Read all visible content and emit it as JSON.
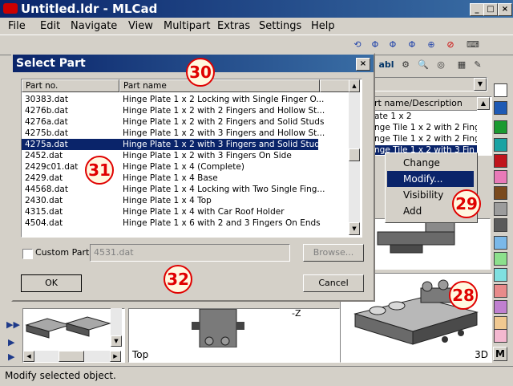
{
  "app": {
    "title": "Untitled.ldr - MLCad"
  },
  "menu": [
    "File",
    "Edit",
    "Navigate",
    "View",
    "Multipart",
    "Extras",
    "Settings",
    "Help"
  ],
  "dialog": {
    "title": "Select Part",
    "columns": [
      "Part no.",
      "Part name"
    ],
    "rows": [
      {
        "no": "30383.dat",
        "name": "Hinge Plate  1 x  2 Locking with Single Finger O..."
      },
      {
        "no": "4276b.dat",
        "name": "Hinge Plate  1 x  2 with 2 Fingers and Hollow St..."
      },
      {
        "no": "4276a.dat",
        "name": "Hinge Plate  1 x  2 with 2 Fingers and Solid Studs"
      },
      {
        "no": "4275b.dat",
        "name": "Hinge Plate  1 x  2 with 3 Fingers and Hollow St..."
      },
      {
        "no": "4275a.dat",
        "name": "Hinge Plate  1 x  2 with 3 Fingers and Solid Studs"
      },
      {
        "no": "2452.dat",
        "name": "Hinge Plate  1 x  2 with 3 Fingers On Side"
      },
      {
        "no": "2429c01.dat",
        "name": "Hinge Plate  1 x  4 (Complete)"
      },
      {
        "no": "2429.dat",
        "name": "Hinge Plate  1 x  4 Base"
      },
      {
        "no": "44568.dat",
        "name": "Hinge Plate  1 x  4 Locking with Two Single Fing..."
      },
      {
        "no": "2430.dat",
        "name": "Hinge Plate  1 x  4 Top"
      },
      {
        "no": "4315.dat",
        "name": "Hinge Plate  1 x  4 with Car Roof Holder"
      },
      {
        "no": "4504.dat",
        "name": "Hinge Plate  1 x  6 with 2 and 3 Fingers On Ends"
      }
    ],
    "selected_index": 4,
    "custom_part_label": "Custom Part:",
    "custom_part_value": "4531.dat",
    "browse_label": "Browse...",
    "ok_label": "OK",
    "cancel_label": "Cancel"
  },
  "right_list": {
    "header": "rt name/Description",
    "rows": [
      "ate  1 x  2",
      "nge Tile  1 x  2 with 2 Fing",
      "nge Tile  1 x  2 with 2 Fing",
      "nge Tile  1 x  2 with 3 Fin"
    ]
  },
  "context_menu": {
    "items": [
      {
        "label": "Change Color...",
        "submenu": false
      },
      {
        "label": "Modify...",
        "submenu": false,
        "highlighted": true
      },
      {
        "label": "Visibility",
        "submenu": true
      },
      {
        "label": "Add",
        "submenu": true
      }
    ]
  },
  "views": {
    "top_label": "Top",
    "axis_label": "-Z",
    "threed_label": "3D"
  },
  "status": {
    "text": "Modify selected object."
  },
  "badges": [
    "30",
    "31",
    "32",
    "29",
    "28"
  ],
  "palette": [
    "#ffffff",
    "#1e5ab4",
    "#1a9a30",
    "#1aa3a3",
    "#c0141c",
    "#e87ab8",
    "#7a4a1e",
    "#9c9c9c",
    "#5a5a5a",
    "#7ab8e8",
    "#8ce08c",
    "#80e0e0",
    "#e88a8a",
    "#c080d0",
    "#f0c890",
    "#f4b8d0",
    "#f4e040",
    "#ffffff"
  ],
  "colors": {
    "accent": "#0a246a",
    "selection": "#0a246a",
    "badge": "#e00000"
  }
}
